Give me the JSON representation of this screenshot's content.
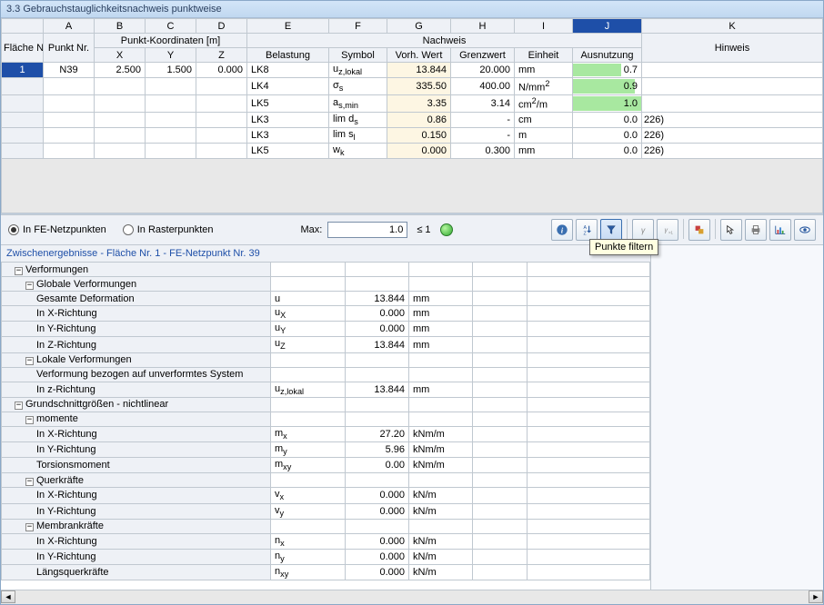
{
  "title": "3.3 Gebrauchstauglichkeitsnachweis punktweise",
  "col_letters": [
    "A",
    "B",
    "C",
    "D",
    "E",
    "F",
    "G",
    "H",
    "I",
    "J",
    "K"
  ],
  "header": {
    "flaeche_nr": "Fläche Nr.",
    "punkt_nr": "Punkt Nr.",
    "punkt_koord": "Punkt-Koordinaten [m]",
    "x": "X",
    "y": "Y",
    "z": "Z",
    "nachweis": "Nachweis",
    "belastung": "Belastung",
    "symbol": "Symbol",
    "vorh_wert": "Vorh. Wert",
    "grenzwert": "Grenzwert",
    "einheit": "Einheit",
    "ausnutzung": "Ausnutzung",
    "hinweis": "Hinweis"
  },
  "rows": [
    {
      "fl": "1",
      "punkt": "N39",
      "x": "2.500",
      "y": "1.500",
      "z": "0.000",
      "bel": "LK8",
      "sym": "u<sub>z,lokal</sub>",
      "vw": "13.844",
      "gw": "20.000",
      "unit": "mm",
      "aus": "0.7",
      "hint": ""
    },
    {
      "fl": "",
      "punkt": "",
      "x": "",
      "y": "",
      "z": "",
      "bel": "LK4",
      "sym": "σ<sub>s</sub>",
      "vw": "335.50",
      "gw": "400.00",
      "unit": "N/mm<sup>2</sup>",
      "aus": "0.9",
      "hint": ""
    },
    {
      "fl": "",
      "punkt": "",
      "x": "",
      "y": "",
      "z": "",
      "bel": "LK5",
      "sym": "a<sub>s,min</sub>",
      "vw": "3.35",
      "gw": "3.14",
      "unit": "cm<sup>2</sup>/m",
      "aus": "1.0",
      "hint": ""
    },
    {
      "fl": "",
      "punkt": "",
      "x": "",
      "y": "",
      "z": "",
      "bel": "LK3",
      "sym": "lim d<sub>s</sub>",
      "vw": "0.86",
      "gw": "-",
      "unit": "cm",
      "aus": "0.0",
      "hint": "226)"
    },
    {
      "fl": "",
      "punkt": "",
      "x": "",
      "y": "",
      "z": "",
      "bel": "LK3",
      "sym": "lim s<sub>l</sub>",
      "vw": "0.150",
      "gw": "-",
      "unit": "m",
      "aus": "0.0",
      "hint": "226)"
    },
    {
      "fl": "",
      "punkt": "",
      "x": "",
      "y": "",
      "z": "",
      "bel": "LK5",
      "sym": "w<sub>k</sub>",
      "vw": "0.000",
      "gw": "0.300",
      "unit": "mm",
      "aus": "0.0",
      "hint": "226)"
    }
  ],
  "toolbar": {
    "radio1": "In FE-Netzpunkten",
    "radio2": "In Rasterpunkten",
    "max_label": "Max:",
    "max_value": "1.0",
    "max_cond": "≤ 1",
    "tooltip": "Punkte filtern"
  },
  "sub": {
    "title": "Zwischenergebnisse  -  Fläche Nr. 1 - FE-Netzpunkt Nr. 39",
    "groups": [
      {
        "t": "Verformungen",
        "lvl": 0,
        "exp": "-"
      },
      {
        "t": "Globale Verformungen",
        "lvl": 1,
        "exp": "-"
      },
      {
        "t": "Gesamte Deformation",
        "lvl": 2,
        "sym": "u",
        "val": "13.844",
        "unit": "mm"
      },
      {
        "t": "In X-Richtung",
        "lvl": 2,
        "sym": "u<sub>X</sub>",
        "val": "0.000",
        "unit": "mm"
      },
      {
        "t": "In Y-Richtung",
        "lvl": 2,
        "sym": "u<sub>Y</sub>",
        "val": "0.000",
        "unit": "mm"
      },
      {
        "t": "In Z-Richtung",
        "lvl": 2,
        "sym": "u<sub>Z</sub>",
        "val": "13.844",
        "unit": "mm"
      },
      {
        "t": "Lokale Verformungen",
        "lvl": 1,
        "exp": "-"
      },
      {
        "t": "Verformung bezogen auf unverformtes System",
        "lvl": 2
      },
      {
        "t": "In z-Richtung",
        "lvl": 2,
        "sym": "u<sub>z,lokal</sub>",
        "val": "13.844",
        "unit": "mm"
      },
      {
        "t": "Grundschnittgrößen - nichtlinear",
        "lvl": 0,
        "exp": "-"
      },
      {
        "t": "momente",
        "lvl": 1,
        "exp": "-"
      },
      {
        "t": "In X-Richtung",
        "lvl": 2,
        "sym": "m<sub>x</sub>",
        "val": "27.20",
        "unit": "kNm/m"
      },
      {
        "t": "In Y-Richtung",
        "lvl": 2,
        "sym": "m<sub>y</sub>",
        "val": "5.96",
        "unit": "kNm/m"
      },
      {
        "t": "Torsionsmoment",
        "lvl": 2,
        "sym": "m<sub>xy</sub>",
        "val": "0.00",
        "unit": "kNm/m"
      },
      {
        "t": "Querkräfte",
        "lvl": 1,
        "exp": "-"
      },
      {
        "t": "In X-Richtung",
        "lvl": 2,
        "sym": "v<sub>x</sub>",
        "val": "0.000",
        "unit": "kN/m"
      },
      {
        "t": "In Y-Richtung",
        "lvl": 2,
        "sym": "v<sub>y</sub>",
        "val": "0.000",
        "unit": "kN/m"
      },
      {
        "t": "Membrankräfte",
        "lvl": 1,
        "exp": "-"
      },
      {
        "t": "In X-Richtung",
        "lvl": 2,
        "sym": "n<sub>x</sub>",
        "val": "0.000",
        "unit": "kN/m"
      },
      {
        "t": "In Y-Richtung",
        "lvl": 2,
        "sym": "n<sub>y</sub>",
        "val": "0.000",
        "unit": "kN/m"
      },
      {
        "t": "Längsquerkräfte",
        "lvl": 2,
        "sym": "n<sub>xy</sub>",
        "val": "0.000",
        "unit": "kN/m"
      }
    ]
  }
}
